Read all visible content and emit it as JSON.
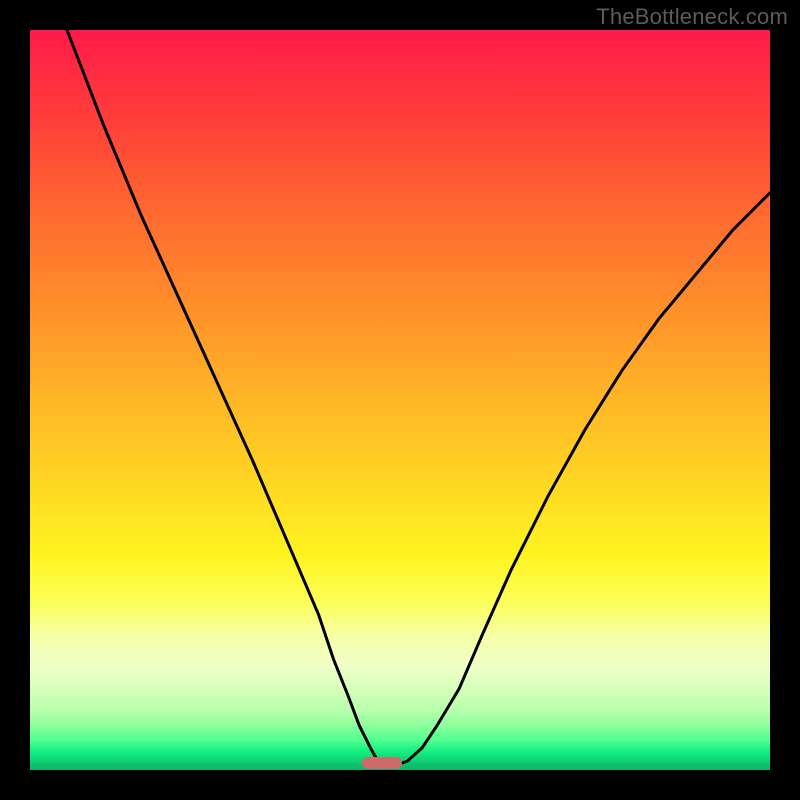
{
  "attribution": "TheBottleneck.com",
  "chart_data": {
    "type": "line",
    "title": "",
    "xlabel": "",
    "ylabel": "",
    "xlim": [
      0,
      100
    ],
    "ylim": [
      0,
      100
    ],
    "grid": false,
    "legend": false,
    "series": [
      {
        "name": "curve",
        "x": [
          5,
          10,
          15,
          20,
          25,
          30,
          33,
          36,
          39,
          41,
          43,
          44.5,
          46,
          47,
          48,
          49,
          51,
          53,
          55,
          58,
          61,
          65,
          70,
          75,
          80,
          85,
          90,
          95,
          100
        ],
        "values": [
          100,
          87,
          75,
          64,
          53,
          42,
          35,
          28,
          21,
          15,
          10,
          6,
          3,
          1.2,
          0.5,
          0.5,
          1.2,
          3,
          6,
          11,
          18,
          27,
          37,
          46,
          54,
          61,
          67,
          73,
          78
        ]
      }
    ],
    "marker": {
      "x": 47.6,
      "width": 5.4,
      "y": 0.2
    },
    "colors": {
      "curve": "#000000",
      "marker": "#cd6a6a",
      "gradient_top": "#ff1a49",
      "gradient_bottom": "#0fb368",
      "frame": "#000000"
    }
  }
}
